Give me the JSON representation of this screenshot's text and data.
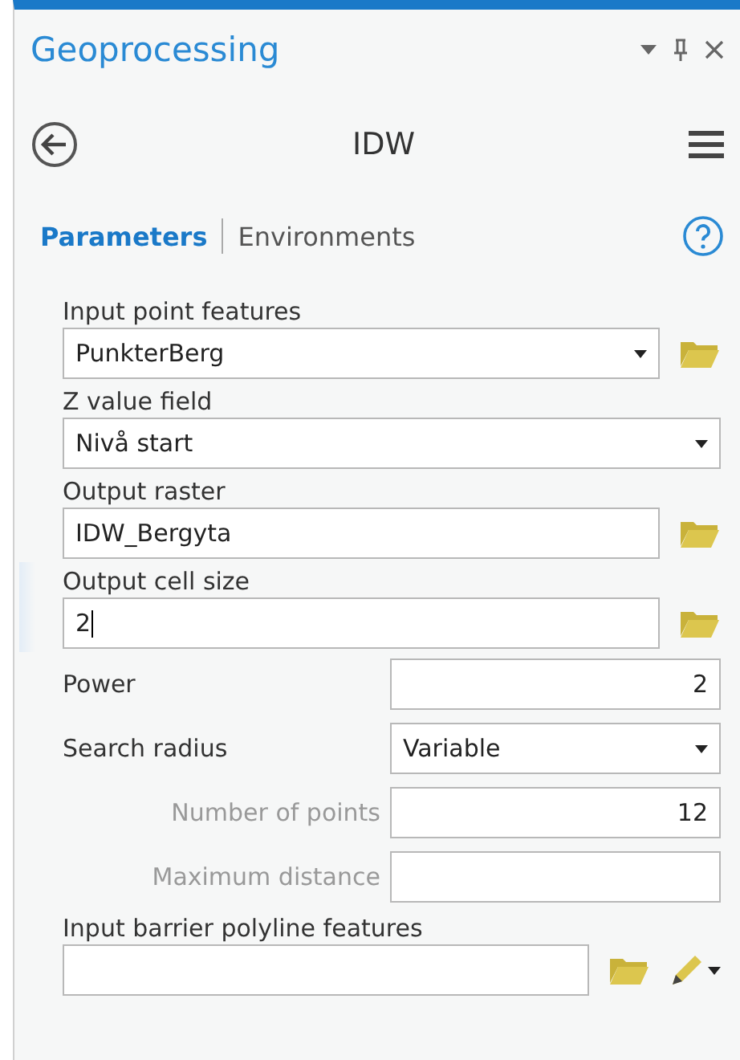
{
  "pane": {
    "title": "Geoprocessing"
  },
  "tool": {
    "title": "IDW"
  },
  "tabs": [
    {
      "label": "Parameters",
      "selected": true
    },
    {
      "label": "Environments",
      "selected": false
    }
  ],
  "parameters": [
    {
      "kind": "stacked",
      "label": "Input point features",
      "value": "PunkterBerg",
      "dropdown": true,
      "browse": true,
      "sketch": false,
      "focused": false
    },
    {
      "kind": "stacked",
      "label": "Z value field",
      "value": "Nivå start",
      "dropdown": true,
      "browse": false,
      "sketch": false,
      "focused": false
    },
    {
      "kind": "stacked",
      "label": "Output raster",
      "value": "IDW_Bergyta",
      "dropdown": false,
      "browse": true,
      "sketch": false,
      "focused": false
    },
    {
      "kind": "stacked",
      "label": "Output cell size",
      "value": "2",
      "dropdown": false,
      "browse": true,
      "sketch": false,
      "focused": true
    },
    {
      "kind": "inline",
      "label": "Power",
      "value": "2",
      "dropdown": false
    },
    {
      "kind": "inline",
      "label": "Search radius",
      "value": "Variable",
      "dropdown": true
    },
    {
      "kind": "sub",
      "label": "Number of points",
      "value": "12",
      "dropdown": false
    },
    {
      "kind": "sub",
      "label": "Maximum distance",
      "dropdown": false
    },
    {
      "kind": "stacked",
      "label": "Input barrier polyline features",
      "dropdown": false,
      "browse": true,
      "sketch": true,
      "focused": false
    }
  ]
}
